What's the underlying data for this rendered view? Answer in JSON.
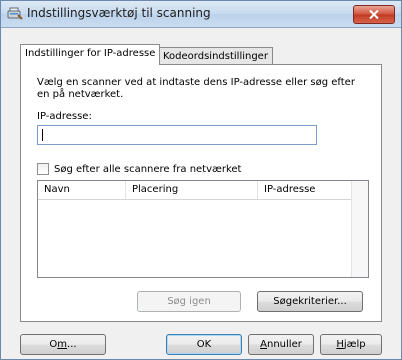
{
  "window": {
    "title": "Indstillingsværktøj til scanning",
    "close_label": "✕"
  },
  "tabs": [
    {
      "label": "Indstillinger for IP-adresse",
      "active": true
    },
    {
      "label": "Kodeordsindstillinger",
      "active": false
    }
  ],
  "panel": {
    "description": "Vælg en scanner ved at indtaste dens IP-adresse eller søg efter en på netværket.",
    "ip_label": "IP-adresse:",
    "ip_value": "",
    "search_all_label": "Søg efter alle scannere fra netværket",
    "search_all_checked": false,
    "list": {
      "columns": [
        "Navn",
        "Placering",
        "IP-adresse"
      ],
      "rows": []
    },
    "search_again_label": "Søg igen",
    "search_criteria_label": "Søgekriterier..."
  },
  "footer": {
    "about": {
      "pre": "O",
      "accel": "m",
      "post": "..."
    },
    "ok": "OK",
    "cancel": {
      "pre": "",
      "accel": "A",
      "post": "nnuller"
    },
    "help": {
      "pre": "",
      "accel": "H",
      "post": "jælp"
    }
  }
}
